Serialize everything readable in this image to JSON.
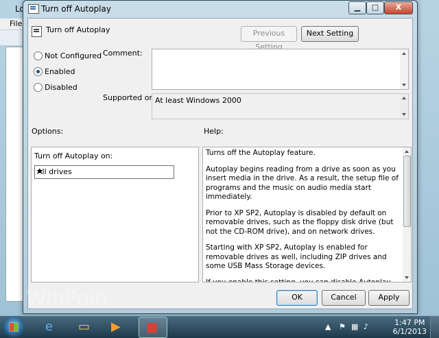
{
  "background_window": {
    "title": "Lo",
    "menu_file": "File"
  },
  "dialog": {
    "title": "Turn off Autoplay",
    "minimize": "▁",
    "maximize": "□",
    "close": "X"
  },
  "policy": {
    "name": "Turn off Autoplay",
    "previous_setting": "Previous Setting",
    "next_setting": "Next Setting"
  },
  "state_options": [
    {
      "label": "Not Configured",
      "selected": false
    },
    {
      "label": "Enabled",
      "selected": true
    },
    {
      "label": "Disabled",
      "selected": false
    }
  ],
  "comment": {
    "label": "Comment:",
    "value": ""
  },
  "supported": {
    "label": "Supported on:",
    "value": "At least Windows 2000"
  },
  "options": {
    "header": "Options:",
    "dropdown_label": "Turn off Autoplay on:",
    "dropdown_value": "All drives"
  },
  "help": {
    "header": "Help:",
    "paragraphs": [
      "Turns off the Autoplay feature.",
      "Autoplay begins reading from a drive as soon as you insert media in the drive. As a result, the setup file of programs and the music on audio media start immediately.",
      "Prior to XP SP2, Autoplay is disabled by default on removable drives, such as the floppy disk drive (but not the CD-ROM drive), and on network drives.",
      "Starting with XP SP2, Autoplay is enabled for removable drives as well, including ZIP drives and some USB Mass Storage devices.",
      "If you enable this setting, you can disable Autoplay on CD-ROM and removable media drives, or disable Autoplay on all drives."
    ]
  },
  "buttons": {
    "ok": "OK",
    "cancel": "Cancel",
    "apply": "Apply"
  },
  "taskbar": {
    "time": "1:47 PM",
    "date": "6/1/2013"
  },
  "watermark": "WinPoin"
}
